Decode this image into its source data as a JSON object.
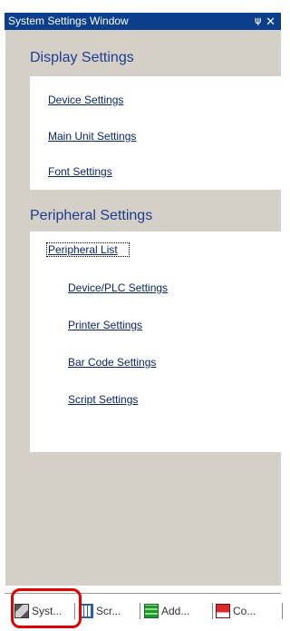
{
  "window": {
    "title": "System Settings Window",
    "pin_glyph": "⍦",
    "close_glyph": "✕"
  },
  "sections": {
    "display": {
      "header": "Display Settings",
      "items": [
        "Device Settings",
        "Main Unit Settings",
        "Font Settings"
      ]
    },
    "peripheral": {
      "header": "Peripheral Settings",
      "list_label": "Peripheral List",
      "items": [
        "Device/PLC Settings",
        "Printer Settings",
        "Bar Code Settings",
        "Script Settings"
      ]
    }
  },
  "tabs": [
    {
      "label": "Syst...",
      "icon": "system-settings-icon",
      "active": true
    },
    {
      "label": "Scr...",
      "icon": "screen-list-icon",
      "active": false
    },
    {
      "label": "Add...",
      "icon": "address-icon",
      "active": false
    },
    {
      "label": "Co...",
      "icon": "common-settings-icon",
      "active": false
    }
  ],
  "colors": {
    "titlebar": "#0b3f8c",
    "panel": "#d4d0c8",
    "section_header": "#1e3d8f",
    "link": "#0a246a",
    "highlight": "#e00000"
  }
}
